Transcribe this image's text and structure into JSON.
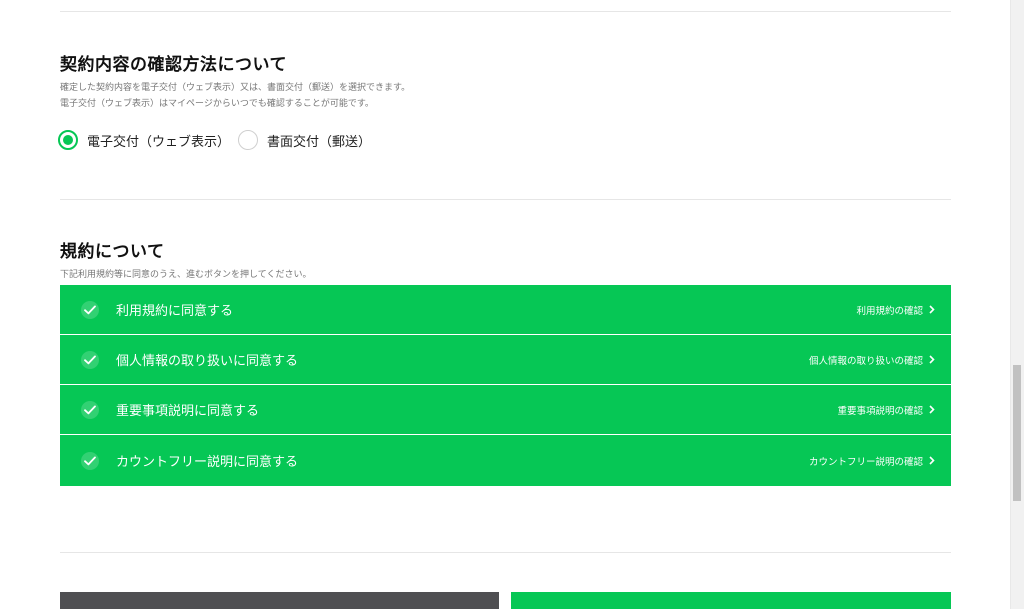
{
  "contract_section": {
    "title": "契約内容の確認方法について",
    "description_line1": "確定した契約内容を電子交付（ウェブ表示）又は、書面交付（郵送）を選択できます。",
    "description_line2": "電子交付（ウェブ表示）はマイページからいつでも確認することが可能です。",
    "options": [
      {
        "label": "電子交付（ウェブ表示）",
        "selected": true
      },
      {
        "label": "書面交付（郵送）",
        "selected": false
      }
    ]
  },
  "terms_section": {
    "title": "規約について",
    "description": "下記利用規約等に同意のうえ、進むボタンを押してください。",
    "items": [
      {
        "label": "利用規約に同意する",
        "link": "利用規約の確認",
        "checked": true
      },
      {
        "label": "個人情報の取り扱いに同意する",
        "link": "個人情報の取り扱いの確認",
        "checked": true
      },
      {
        "label": "重要事項説明に同意する",
        "link": "重要事項説明の確認",
        "checked": true
      },
      {
        "label": "カウントフリー説明に同意する",
        "link": "カウントフリー説明の確認",
        "checked": true
      }
    ]
  },
  "colors": {
    "accent": "#06c755",
    "back_button": "#4f4f52",
    "divider": "#e6e6e6"
  },
  "icons": {
    "check": "check-icon",
    "chevron": "chevron-right-icon",
    "radio": "radio-icon"
  }
}
